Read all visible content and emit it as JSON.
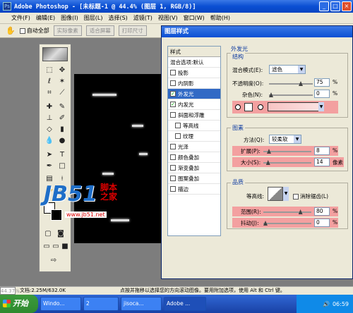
{
  "window": {
    "title": "Adobe Photoshop - [未标题-1 @ 44.4% (图层 1, RGB/8)]"
  },
  "menu": [
    "文件(F)",
    "编辑(E)",
    "图像(I)",
    "图层(L)",
    "选择(S)",
    "滤镜(T)",
    "视图(V)",
    "窗口(W)",
    "帮助(H)"
  ],
  "options": {
    "auto_select": "自动全部",
    "btn1": "实际像素",
    "btn2": "适合屏幕",
    "btn3": "打印尺寸"
  },
  "dialog": {
    "title": "图层样式",
    "styles_header": "样式",
    "blend_options": "混合选项:默认",
    "styles": [
      {
        "label": "投影",
        "checked": false,
        "sub": false
      },
      {
        "label": "内阴影",
        "checked": false,
        "sub": false
      },
      {
        "label": "外发光",
        "checked": true,
        "sub": false,
        "selected": true
      },
      {
        "label": "内发光",
        "checked": true,
        "sub": false
      },
      {
        "label": "斜面和浮雕",
        "checked": false,
        "sub": false
      },
      {
        "label": "等高线",
        "checked": false,
        "sub": true
      },
      {
        "label": "纹理",
        "checked": false,
        "sub": true
      },
      {
        "label": "光泽",
        "checked": false,
        "sub": false
      },
      {
        "label": "颜色叠加",
        "checked": false,
        "sub": false
      },
      {
        "label": "渐变叠加",
        "checked": false,
        "sub": false
      },
      {
        "label": "图案叠加",
        "checked": false,
        "sub": false
      },
      {
        "label": "描边",
        "checked": false,
        "sub": false
      }
    ],
    "outer_glow_title": "外发光",
    "structure_title": "结构",
    "blend_mode_label": "混合模式(E):",
    "blend_mode_value": "滤色",
    "opacity_label": "不透明度(O):",
    "opacity_value": "75",
    "opacity_fraction": 0.75,
    "noise_label": "杂色(N):",
    "noise_value": "0",
    "noise_fraction": 0,
    "elements_title": "图素",
    "method_label": "方法(Q):",
    "method_value": "较柔软",
    "spread_label": "扩展(P):",
    "spread_value": "8",
    "spread_fraction": 0.08,
    "size_label": "大小(S):",
    "size_value": "14",
    "size_fraction": 0.06,
    "size_unit": "像素",
    "quality_title": "品质",
    "contour_label": "等高线:",
    "antialias_label": "消除锯齿(L)",
    "range_label": "范围(R):",
    "range_value": "80",
    "range_fraction": 0.8,
    "jitter_label": "抖动(J):",
    "jitter_value": "0",
    "jitter_fraction": 0,
    "percent": "%",
    "highlight_color": "#f3a0a0"
  },
  "watermark": {
    "logo": "JB51",
    "cn": "脚本之家",
    "url": "www.jb51.net"
  },
  "status": {
    "zoom": "44.37%",
    "doc": "文档:2.25M/632.0K",
    "hint": "点按并拖移以选择您的方向滚动图像。要用附加选项，使用 Alt 和 Ctrl 键。"
  },
  "taskbar": {
    "start": "开始",
    "tasks": [
      "Windo...",
      "2",
      "jisoca...",
      "Adobe ..."
    ],
    "clock": "06:59"
  }
}
